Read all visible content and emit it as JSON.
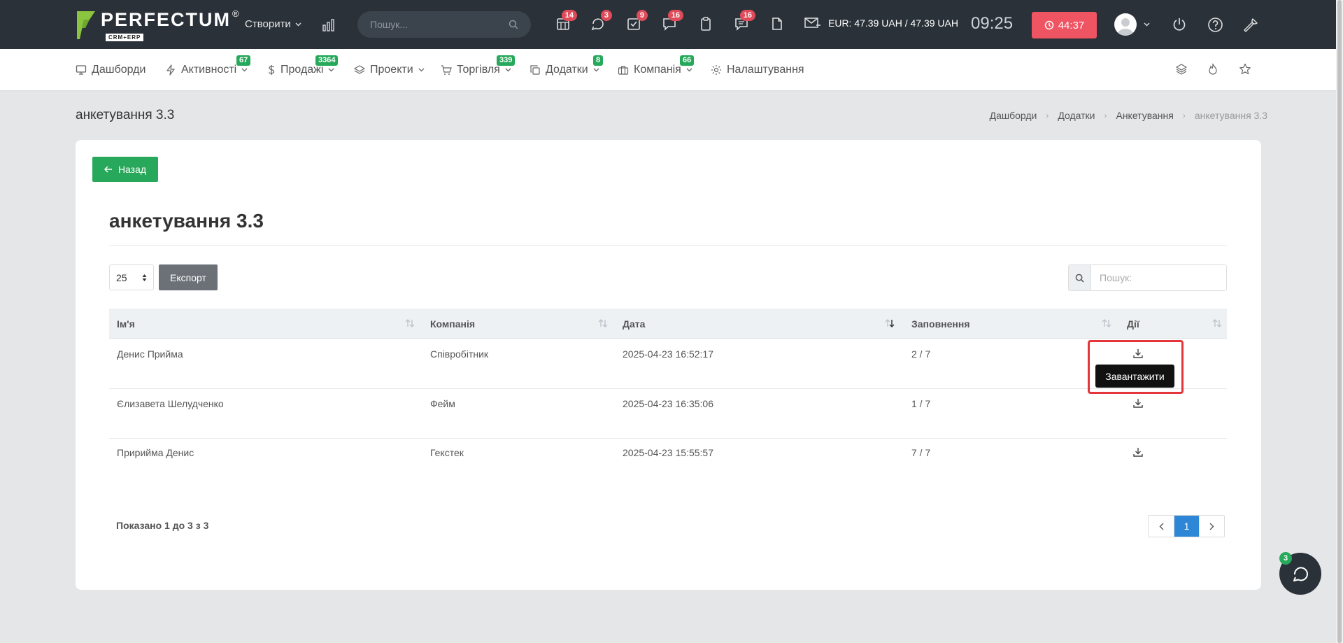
{
  "header": {
    "logo": "PERFECTUM",
    "logo_reg": "®",
    "logo_sub": "CRM+ERP",
    "create_label": "Створити",
    "search_placeholder": "Пошук...",
    "badges": {
      "calendar": "14",
      "chat": "3",
      "tasks": "9",
      "messages": "16",
      "clipboard": "",
      "comments": "16",
      "docs": ""
    },
    "currency_text": "EUR: 47.39 UAH / 47.39 UAH",
    "clock": "09:25",
    "timer": "44:37"
  },
  "nav": {
    "items": [
      {
        "label": "Дашборди",
        "badge": "",
        "icon": "monitor-icon"
      },
      {
        "label": "Активності",
        "badge": "67",
        "icon": "bolt-icon"
      },
      {
        "label": "Продажі",
        "badge": "3364",
        "icon": "dollar-icon"
      },
      {
        "label": "Проекти",
        "badge": "",
        "icon": "layers-icon"
      },
      {
        "label": "Торгівля",
        "badge": "339",
        "icon": "cart-icon"
      },
      {
        "label": "Додатки",
        "badge": "8",
        "icon": "copy-icon"
      },
      {
        "label": "Компанія",
        "badge": "66",
        "icon": "briefcase-icon"
      },
      {
        "label": "Налаштування",
        "badge": "",
        "icon": "gear-icon"
      }
    ]
  },
  "page": {
    "title": "анкетування 3.3",
    "breadcrumbs": [
      "Дашборди",
      "Додатки",
      "Анкетування",
      "анкетування 3.3"
    ]
  },
  "card": {
    "back_label": "Назад",
    "heading": "анкетування 3.3",
    "per_page": "25",
    "export_label": "Експорт",
    "search_placeholder": "Пошук:",
    "columns": [
      "Ім'я",
      "Компанія",
      "Дата",
      "Заповнення",
      "Дії"
    ],
    "rows": [
      {
        "name": "Денис Прийма",
        "company": "Співробітник",
        "date": "2025-04-23 16:52:17",
        "fill": "2 / 7"
      },
      {
        "name": "Єлизавета Шелудченко",
        "company": "Фейм",
        "date": "2025-04-23 16:35:06",
        "fill": "1 / 7"
      },
      {
        "name": "Пририйма Денис",
        "company": "Гекстек",
        "date": "2025-04-23 15:55:57",
        "fill": "7 / 7"
      }
    ],
    "tooltip": "Завантажити",
    "shown_text": "Показано 1 до 3 з 3",
    "pagination": {
      "current": "1"
    }
  },
  "chat_badge": "3",
  "colors": {
    "topbar": "#2a3139",
    "accent_green": "#28a85a",
    "badge_red": "#e04b59",
    "timer_red": "#ef5463",
    "page_blue": "#2e86d6"
  }
}
